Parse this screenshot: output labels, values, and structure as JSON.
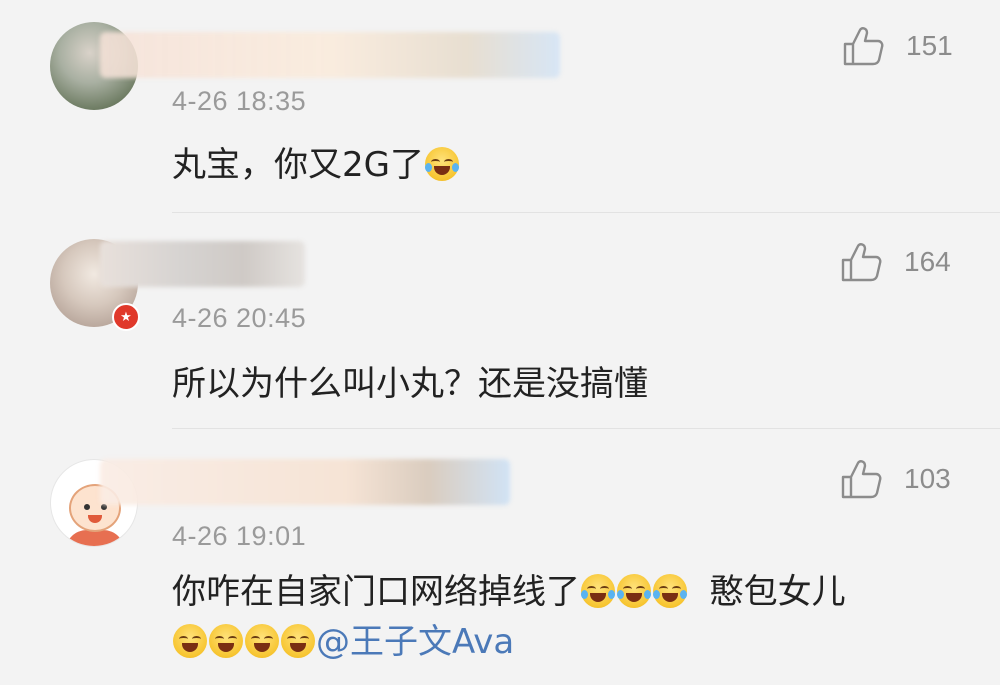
{
  "comments": [
    {
      "time": "4-26 18:35",
      "text_before_emoji": "丸宝，你又2G了",
      "emoji_name": "laugh-cry-emoji",
      "likes": "151"
    },
    {
      "time": "4-26 20:45",
      "text": "所以为什么叫小丸？还是没搞懂",
      "likes": "164",
      "badge": "vip-badge"
    },
    {
      "time": "4-26 19:01",
      "text_line1": "你咋在自家门口网络掉线了",
      "text_line1_tail": "  憨包女儿",
      "mention": "@王子文Ava",
      "likes": "103"
    }
  ],
  "colors": {
    "background": "#f3f3f3",
    "text": "#222222",
    "meta": "#9a9a9a",
    "mention": "#4b79b8"
  },
  "icons": {
    "like": "thumbs-up-icon",
    "emoji": "laugh-cry-emoji"
  }
}
